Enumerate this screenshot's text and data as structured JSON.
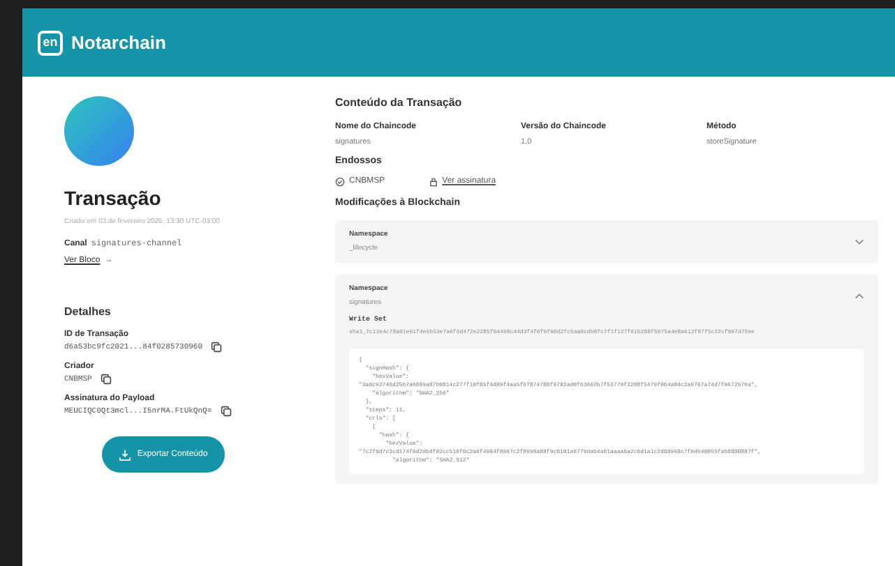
{
  "header": {
    "logo_mark": "en",
    "brand": "Notarchain"
  },
  "transaction": {
    "title": "Transação",
    "created": "Criado em 03 de fevereiro 2025, 13:30 UTC-03:00",
    "channel_label": "Canal",
    "channel": "signatures-channel",
    "block_link": "Ver Bloco",
    "block_arrow": "→"
  },
  "details": {
    "title": "Detalhes",
    "fields": [
      {
        "label": "ID de Transação",
        "value": "d6a53bc9fc2021...84f0285730960"
      },
      {
        "label": "Criador",
        "value": "CNBMSP"
      },
      {
        "label": "Assinatura do Payload",
        "value": "MEUCIQC0Qt3mcl...I5nrMA.FtUkQnQ="
      }
    ],
    "export_button": "Exportar Conteúdo"
  },
  "content": {
    "title": "Conteúdo da Transação",
    "fields": [
      {
        "label": "Nome do Chaincode",
        "value": "signatures"
      },
      {
        "label": "Versão do Chaincode",
        "value": "1.0"
      },
      {
        "label": "Método",
        "value": "storeSignature"
      }
    ],
    "endorsements_label": "Endossos",
    "endorser": "CNBMSP",
    "signature_link": "Ver assinatura",
    "modifications_title": "Modificações à Blockchain",
    "namespaces": [
      {
        "label": "Namespace",
        "value": "_lifecycle",
        "expanded": false
      },
      {
        "label": "Namespace",
        "value": "signatures",
        "expanded": true,
        "write_set_label": "Write Set",
        "write_set_key": "sha1_7c13e4c78a01e61f4e5b53e7a6f6d472e2285f04498c44d3f4f6f9f60d2fc5aa6cdb8fc7f1f127f61b288f5975a4e8a612f87f5c22cf097d759e",
        "code": [
          "{",
          "  \"signHash\": {",
          "    \"hexValue\":",
          "\"3a0c92746d25b7a6089a87b0814c277f10f85f4d89f4aa5fb7874788f0782ad0f63662b7f53779f2208f5479f0b4a8dc2a6767a74d7f9672579a\",",
          "    \"algorithm\": \"SHA2_256\"",
          "  },",
          "  \"steps\": 11,",
          "  \"crls\": [",
          "    {",
          "      \"hash\": {",
          "        \"hexValue\":",
          "\"7c2f6d7c3cd174f6d2db4f02cc516f0c2a6f4984f0967c2f8990a88f9c0101a6779dab4a61aaaa6a2c6d1a1c2d88998c7f9db40055fab8880887f\",",
          "          \"algorithm\": \"SHA2_512\""
        ]
      }
    ]
  }
}
